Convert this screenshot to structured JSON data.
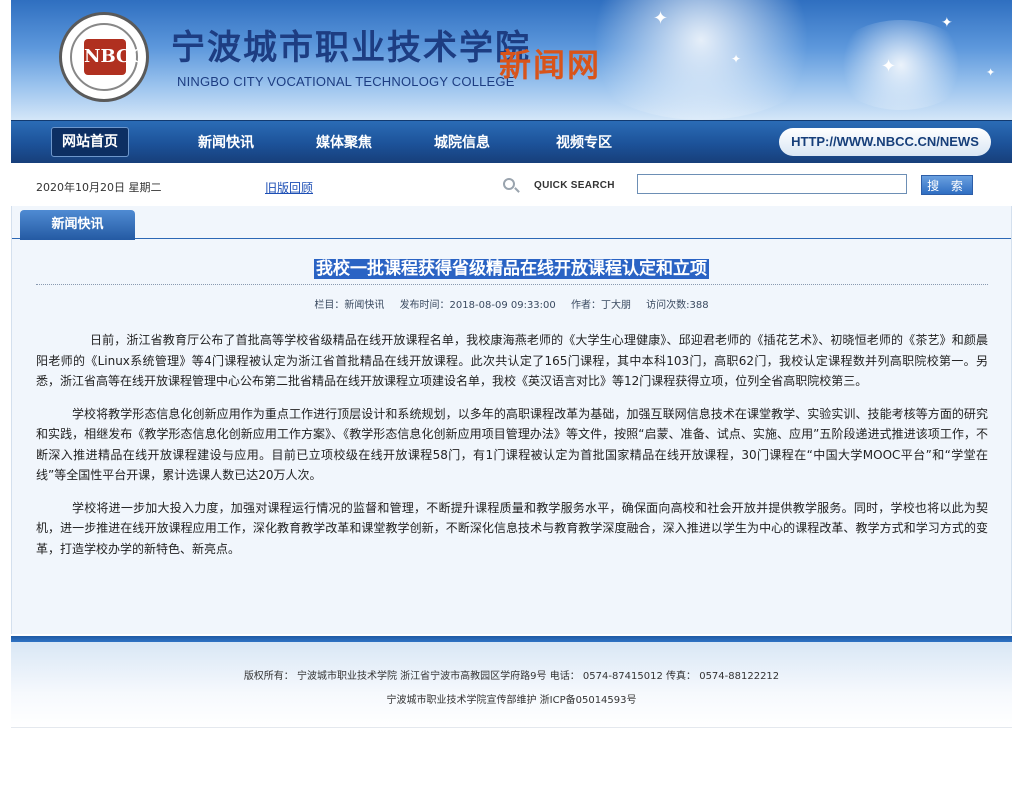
{
  "header": {
    "logo_text": "NBCC",
    "logo_ring_text": "NINGBO CITY COLLEGE OF VOCATIONAL TECHNOLOGY",
    "cn_title": "宁波城市职业技术学院",
    "en_title": "NINGBO CITY VOCATIONAL TECHNOLOGY COLLEGE",
    "news_title": "新闻网"
  },
  "nav": {
    "items": [
      {
        "label": "网站首页",
        "active": true
      },
      {
        "label": "新闻快讯"
      },
      {
        "label": "媒体聚焦"
      },
      {
        "label": "城院信息"
      },
      {
        "label": "视频专区"
      }
    ],
    "url": "HTTP://WWW.NBCC.CN/NEWS"
  },
  "utility": {
    "date": "2020年10月20日  星期二",
    "old_site": "旧版回顾",
    "quick_search": "QUICK SEARCH",
    "search_value": "",
    "search_button": "搜 索"
  },
  "section": {
    "tab": "新闻快讯"
  },
  "article": {
    "title": "我校一批课程获得省级精品在线开放课程认定和立项",
    "meta": {
      "column": "栏目：新闻快讯",
      "published": "发布时间：2018-08-09 09:33:00",
      "author": "作者：丁大朋",
      "visits": "访问次数:388"
    },
    "paragraphs": [
      "日前，浙江省教育厅公布了首批高等学校省级精品在线开放课程名单，我校康海燕老师的《大学生心理健康》、邱迎君老师的《插花艺术》、初晓恒老师的《茶艺》和颜晨阳老师的《Linux系统管理》等4门课程被认定为浙江省首批精品在线开放课程。此次共认定了165门课程，其中本科103门，高职62门，我校认定课程数并列高职院校第一。另悉，浙江省高等在线开放课程管理中心公布第二批省精品在线开放课程立项建设名单，我校《英汉语言对比》等12门课程获得立项，位列全省高职院校第三。",
      "学校将教学形态信息化创新应用作为重点工作进行顶层设计和系统规划，以多年的高职课程改革为基础，加强互联网信息技术在课堂教学、实验实训、技能考核等方面的研究和实践，相继发布《教学形态信息化创新应用工作方案》、《教学形态信息化创新应用项目管理办法》等文件，按照“启蒙、准备、试点、实施、应用”五阶段递进式推进该项工作，不断深入推进精品在线开放课程建设与应用。目前已立项校级在线开放课程58门，有1门课程被认定为首批国家精品在线开放课程，30门课程在“中国大学MOOC平台”和“学堂在线”等全国性平台开课，累计选课人数已达20万人次。",
      "学校将进一步加大投入力度，加强对课程运行情况的监督和管理，不断提升课程质量和教学服务水平，确保面向高校和社会开放并提供教学服务。同时，学校也将以此为契机，进一步推进在线开放课程应用工作，深化教育教学改革和课堂教学创新，不断深化信息技术与教育教学深度融合，深入推进以学生为中心的课程改革、教学方式和学习方式的变革，打造学校办学的新特色、新亮点。"
    ]
  },
  "footer": {
    "line1": "版权所有： 宁波城市职业技术学院  浙江省宁波市高教园区学府路9号  电话： 0574-87415012  传真： 0574-88122212",
    "line2": "宁波城市职业技术学院宣传部维护  浙ICP备05014593号"
  },
  "colors": {
    "nav_blue": "#1c5299",
    "title_highlight": "#2a63c4",
    "news_orange": "#d8541a"
  }
}
